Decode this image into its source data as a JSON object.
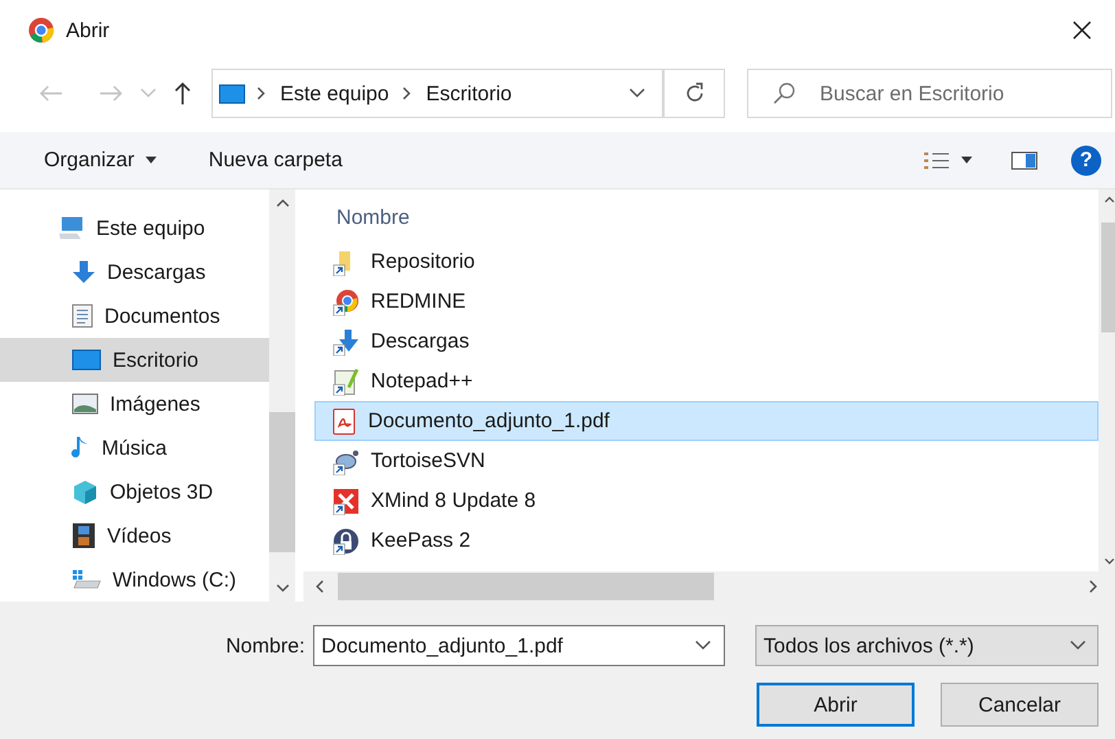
{
  "window": {
    "title": "Abrir"
  },
  "address": {
    "path": [
      "Este equipo",
      "Escritorio"
    ]
  },
  "search": {
    "placeholder": "Buscar en Escritorio"
  },
  "toolbar": {
    "organize": "Organizar",
    "new_folder": "Nueva carpeta",
    "help": "?"
  },
  "sidebar": {
    "items": [
      {
        "label": "Este equipo",
        "selected": false,
        "children": [
          {
            "label": "Descargas",
            "selected": false
          },
          {
            "label": "Documentos",
            "selected": false
          },
          {
            "label": "Escritorio",
            "selected": true
          },
          {
            "label": "Imágenes",
            "selected": false
          },
          {
            "label": "Música",
            "selected": false
          },
          {
            "label": "Objetos 3D",
            "selected": false
          },
          {
            "label": "Vídeos",
            "selected": false
          },
          {
            "label": "Windows (C:)",
            "selected": false
          }
        ]
      }
    ]
  },
  "file_list": {
    "column": "Nombre",
    "rows": [
      {
        "name": "Repositorio",
        "selected": false
      },
      {
        "name": "REDMINE",
        "selected": false
      },
      {
        "name": "Descargas",
        "selected": false
      },
      {
        "name": "Notepad++",
        "selected": false
      },
      {
        "name": "Documento_adjunto_1.pdf",
        "selected": true
      },
      {
        "name": "TortoiseSVN",
        "selected": false
      },
      {
        "name": "XMind 8 Update 8",
        "selected": false
      },
      {
        "name": "KeePass 2",
        "selected": false
      }
    ]
  },
  "footer": {
    "name_label": "Nombre:",
    "name_value": "Documento_adjunto_1.pdf",
    "filter": "Todos los archivos (*.*)",
    "buttons": [
      "Abrir",
      "Cancelar"
    ]
  }
}
